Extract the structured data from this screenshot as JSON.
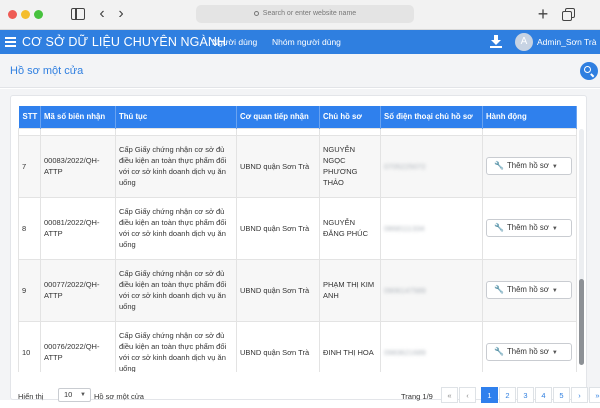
{
  "browser": {
    "url_placeholder": "Search or enter website name",
    "back_glyph": "‹",
    "forward_glyph": "›",
    "new_tab_glyph": "+"
  },
  "nav": {
    "title": "CƠ SỞ DỮ LIỆU CHUYÊN NGÀNH",
    "links": [
      "Người dùng",
      "Nhóm người dùng"
    ],
    "avatar_initial": "A",
    "username": "Admin_Sơn Trà",
    "accent_color": "#2f7fe0"
  },
  "page": {
    "title": "Hồ sơ một cửa"
  },
  "table": {
    "headers": [
      "STT",
      "Mã số biên nhận",
      "Thủ tục",
      "Cơ quan tiếp nhận",
      "Chủ hồ sơ",
      "Số điện thoại chủ hồ sơ",
      "Hành động"
    ],
    "rows": [
      {
        "stt": "",
        "code": "",
        "procedure": "",
        "agency": "",
        "owner": "",
        "phone": "",
        "action": ""
      },
      {
        "stt": "7",
        "code": "00083/2022/QH-ATTP",
        "procedure": "Cấp Giấy chứng nhận cơ sở đủ điều kiện an toàn thực phẩm đối với cơ sở kinh doanh dịch vụ ăn uống",
        "agency": "UBND quận Sơn Trà",
        "owner": "NGUYỄN NGỌC PHƯƠNG THẢO",
        "phone": "0705225072",
        "action": "Thêm hồ sơ"
      },
      {
        "stt": "8",
        "code": "00081/2022/QH-ATTP",
        "procedure": "Cấp Giấy chứng nhận cơ sở đủ điều kiện an toàn thực phẩm đối với cơ sở kinh doanh dịch vụ ăn uống",
        "agency": "UBND quận Sơn Trà",
        "owner": "NGUYỄN ĐĂNG PHÚC",
        "phone": "0868111334",
        "action": "Thêm hồ sơ"
      },
      {
        "stt": "9",
        "code": "00077/2022/QH-ATTP",
        "procedure": "Cấp Giấy chứng nhận cơ sở đủ điều kiện an toàn thực phẩm đối với cơ sở kinh doanh dịch vụ ăn uống",
        "agency": "UBND quận Sơn Trà",
        "owner": "PHẠM THỊ KIM ANH",
        "phone": "0906147589",
        "action": "Thêm hồ sơ"
      },
      {
        "stt": "10",
        "code": "00076/2022/QH-ATTP",
        "procedure": "Cấp Giấy chứng nhận cơ sở đủ điều kiện an toàn thực phẩm đối với cơ sở kinh doanh dịch vụ ăn uống",
        "agency": "UBND quận Sơn Trà",
        "owner": "ĐINH THỊ HOA",
        "phone": "0983621689",
        "action": "Thêm hồ sơ"
      }
    ]
  },
  "footer": {
    "show_label": "Hiển thị",
    "page_size": "10",
    "per_label": "Hồ sơ một cửa",
    "page_info": "Trang 1/9",
    "pages": [
      "«",
      "‹",
      "1",
      "2",
      "3",
      "4",
      "5",
      "›",
      "»"
    ],
    "current_page": "1"
  }
}
